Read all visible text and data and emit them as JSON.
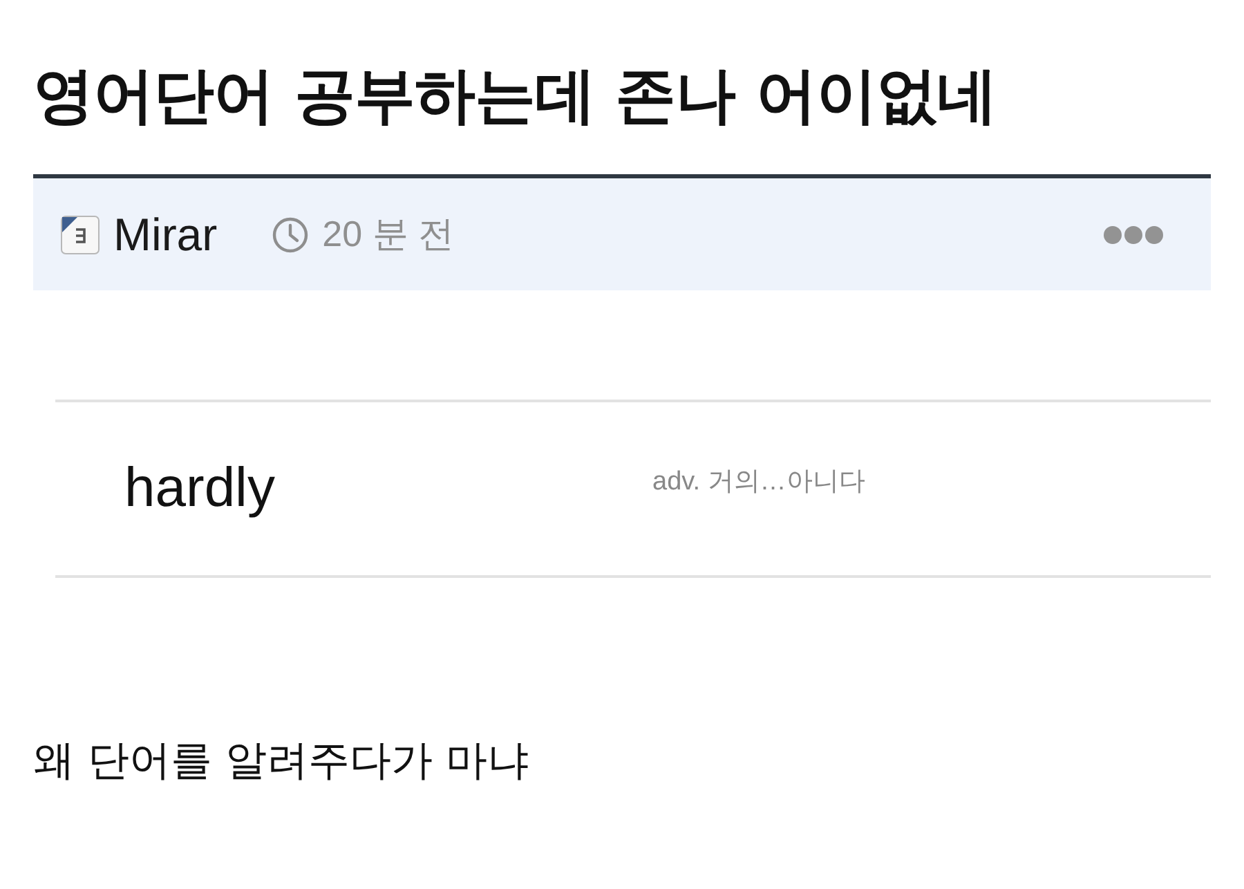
{
  "post": {
    "title": "영어단어 공부하는데 존나 어이없네"
  },
  "meta": {
    "author": "Mirar",
    "time": "20 분 전"
  },
  "dictionary_entry": {
    "word": "hardly",
    "definition": "adv. 거의…아니다"
  },
  "body": {
    "text": "왜 단어를 알려주다가 마냐"
  }
}
